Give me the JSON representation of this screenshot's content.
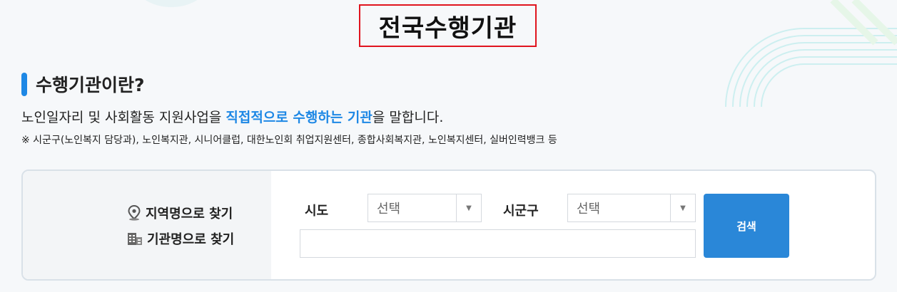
{
  "page": {
    "title": "전국수행기관"
  },
  "section": {
    "title": "수행기관이란?",
    "desc_before": "노인일자리 및 사회활동 지원사업을 ",
    "desc_highlight": "직접적으로 수행하는 기관",
    "desc_after": "을 말합니다.",
    "note": "※ 시군구(노인복지 담당과), 노인복지관, 시니어클럽, 대한노인회 취업지원센터, 종합사회복지관, 노인복지센터, 실버인력뱅크 등"
  },
  "search": {
    "modes": [
      {
        "label": "지역명으로 찾기",
        "icon": "location-pin-icon"
      },
      {
        "label": "기관명으로 찾기",
        "icon": "building-icon"
      }
    ],
    "sido_label": "시도",
    "sido_value": "선택",
    "sigungu_label": "시군구",
    "sigungu_value": "선택",
    "keyword_value": "",
    "button_label": "검색"
  },
  "colors": {
    "accent": "#1e88e5",
    "button": "#2a87d8",
    "title_border": "#e0141e"
  }
}
